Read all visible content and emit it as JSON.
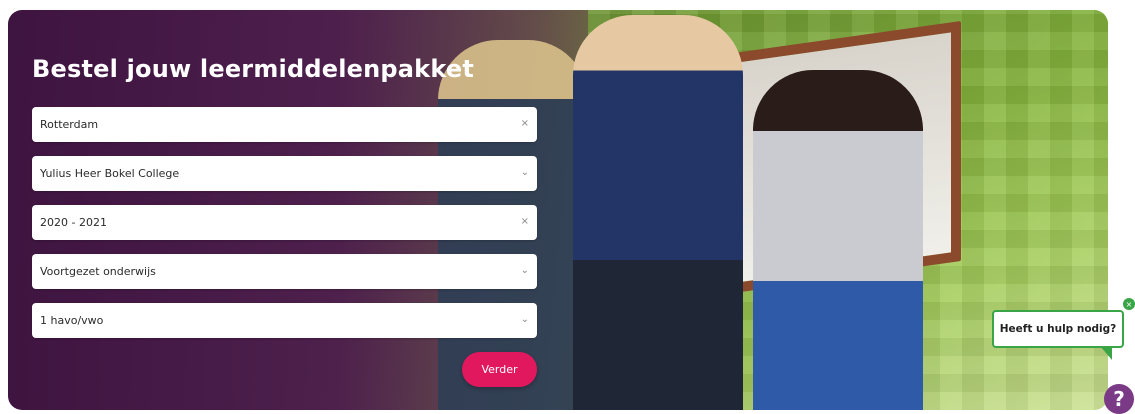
{
  "hero": {
    "title": "Bestel jouw leermiddelenpakket"
  },
  "form": {
    "fields": [
      {
        "value": "Rotterdam",
        "icon": "clear-icon",
        "glyph": "×"
      },
      {
        "value": "Yulius Heer Bokel College",
        "icon": "chevron-down-icon",
        "glyph": "⌄"
      },
      {
        "value": "2020 - 2021",
        "icon": "clear-icon",
        "glyph": "×"
      },
      {
        "value": "Voortgezet onderwijs",
        "icon": "chevron-down-icon",
        "glyph": "⌄"
      },
      {
        "value": "1 havo/vwo",
        "icon": "chevron-down-icon",
        "glyph": "⌄"
      }
    ],
    "submit_label": "Verder"
  },
  "help": {
    "label": "Heeft u hulp nodig?",
    "badge": "×",
    "icon_glyph": "?"
  },
  "colors": {
    "brand_purple": "#4b194e",
    "button_pink": "#e2185e",
    "help_green": "#3aa547"
  }
}
